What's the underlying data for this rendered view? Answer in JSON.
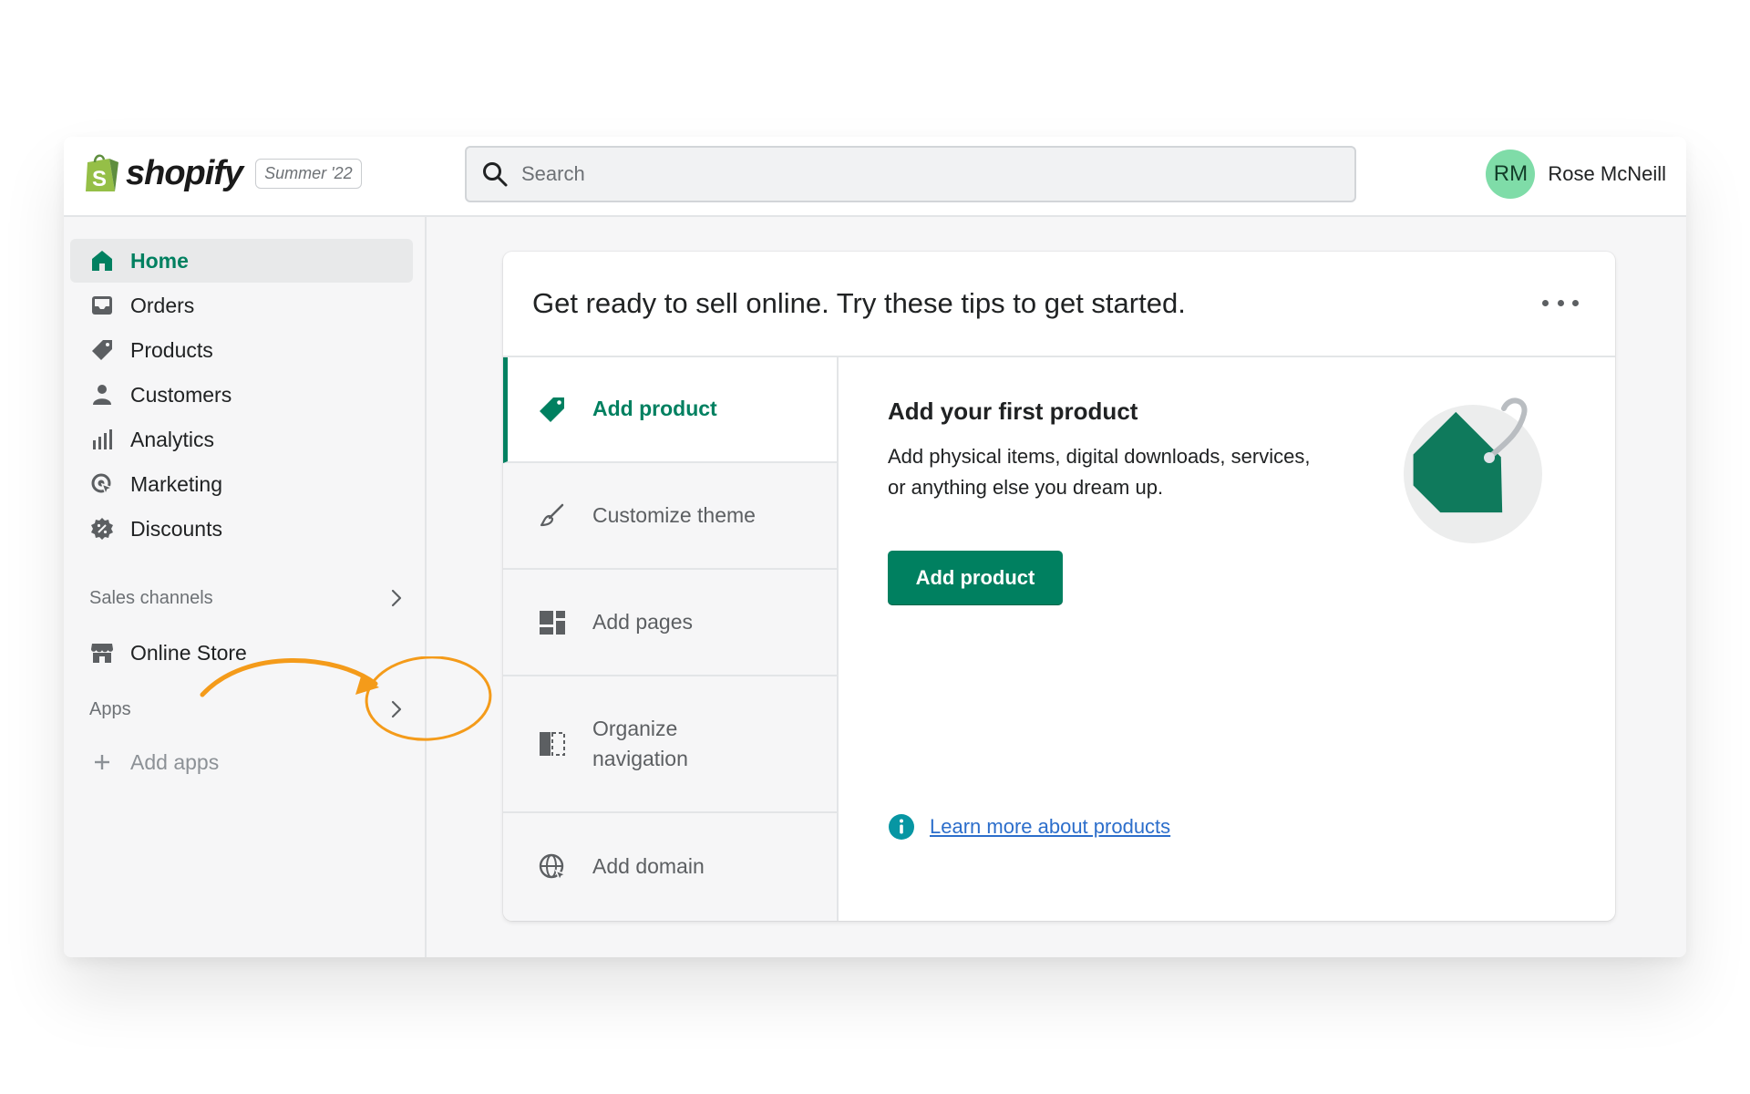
{
  "brand": {
    "name": "shopify",
    "edition": "Summer '22"
  },
  "search": {
    "placeholder": "Search"
  },
  "user": {
    "initials": "RM",
    "name": "Rose McNeill"
  },
  "sidebar": {
    "items": [
      {
        "label": "Home",
        "icon": "home-icon",
        "active": true
      },
      {
        "label": "Orders",
        "icon": "inbox-icon"
      },
      {
        "label": "Products",
        "icon": "tag-icon"
      },
      {
        "label": "Customers",
        "icon": "person-icon"
      },
      {
        "label": "Analytics",
        "icon": "bar-chart-icon"
      },
      {
        "label": "Marketing",
        "icon": "target-icon"
      },
      {
        "label": "Discounts",
        "icon": "discount-icon"
      }
    ],
    "sales_channels": {
      "header": "Sales channels",
      "items": [
        {
          "label": "Online Store",
          "icon": "store-icon"
        }
      ]
    },
    "apps": {
      "header": "Apps",
      "add_label": "Add apps"
    }
  },
  "card": {
    "title": "Get ready to sell online. Try these tips to get started.",
    "tabs": [
      {
        "label": "Add product",
        "icon": "tag-icon",
        "active": true
      },
      {
        "label": "Customize theme",
        "icon": "brush-icon"
      },
      {
        "label": "Add pages",
        "icon": "layout-icon"
      },
      {
        "label": "Organize navigation",
        "icon": "navigation-icon"
      },
      {
        "label": "Add domain",
        "icon": "globe-icon"
      }
    ],
    "detail": {
      "title": "Add your first product",
      "description": "Add physical items, digital downloads, services, or anything else you dream up.",
      "button": "Add product",
      "link": "Learn more about products"
    }
  },
  "colors": {
    "accent": "#008060",
    "annotation": "#f49b1a",
    "link": "#2c6ecb",
    "info": "#0796a3"
  }
}
